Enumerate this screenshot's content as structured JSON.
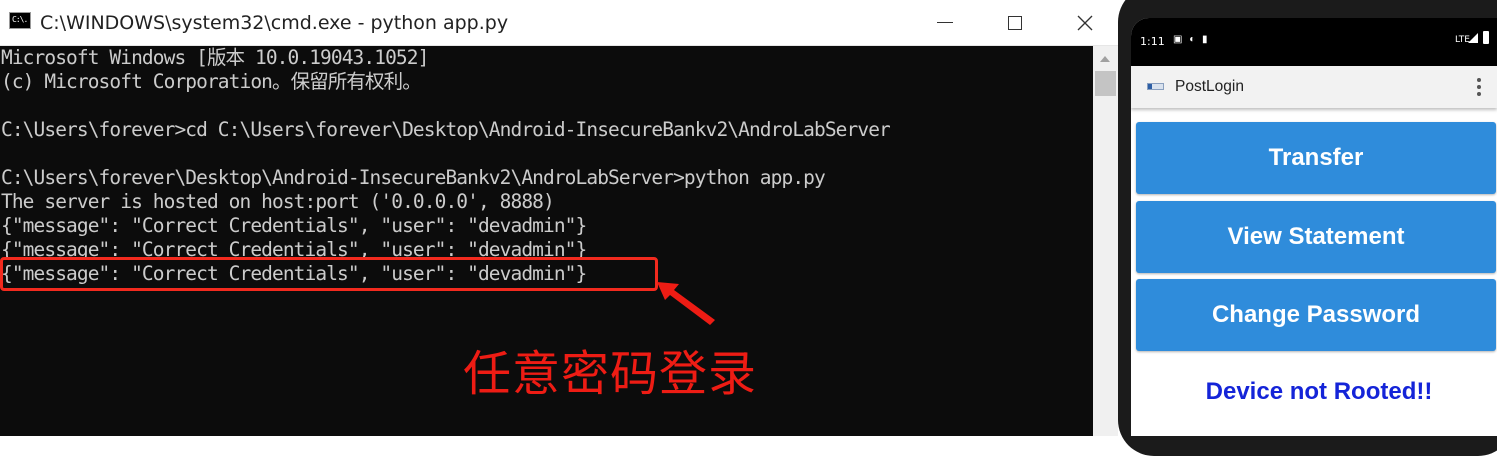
{
  "cmd": {
    "app_icon_text": "C:\\.",
    "title": "C:\\WINDOWS\\system32\\cmd.exe - python  app.py",
    "lines": [
      "Microsoft Windows [版本 10.0.19043.1052]",
      "(c) Microsoft Corporation。保留所有权利。",
      "",
      "C:\\Users\\forever>cd C:\\Users\\forever\\Desktop\\Android-InsecureBankv2\\AndroLabServer",
      "",
      "C:\\Users\\forever\\Desktop\\Android-InsecureBankv2\\AndroLabServer>python app.py",
      "The server is hosted on host:port ('0.0.0.0', 8888)",
      "{\"message\": \"Correct Credentials\", \"user\": \"devadmin\"}",
      "{\"message\": \"Correct Credentials\", \"user\": \"devadmin\"}",
      "{\"message\": \"Correct Credentials\", \"user\": \"devadmin\"}"
    ]
  },
  "annotation": {
    "text": "任意密码登录",
    "color": "#ee1c14"
  },
  "phone": {
    "status": {
      "time": "1:11",
      "notification_icons": "▣ ◐ ▮",
      "network": "LTE"
    },
    "app_bar": {
      "title": "PostLogin"
    },
    "buttons": {
      "transfer": "Transfer",
      "view_statement": "View Statement",
      "change_password": "Change Password"
    },
    "root_status": "Device not Rooted!!",
    "colors": {
      "button_bg": "#2f8cdb",
      "root_status": "#1424d8"
    }
  }
}
